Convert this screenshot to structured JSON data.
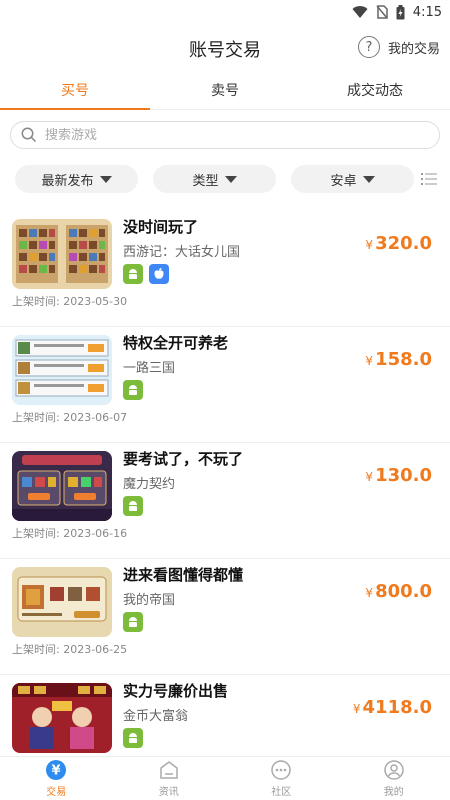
{
  "status": {
    "time": "4:15"
  },
  "header": {
    "title": "账号交易",
    "help_icon": "?",
    "my_trade": "我的交易"
  },
  "tabs": [
    {
      "label": "买号",
      "active": true
    },
    {
      "label": "卖号",
      "active": false
    },
    {
      "label": "成交动态",
      "active": false
    }
  ],
  "search": {
    "placeholder": "搜索游戏",
    "value": ""
  },
  "filters": [
    {
      "label": "最新发布"
    },
    {
      "label": "类型"
    },
    {
      "label": "安卓"
    }
  ],
  "listings": [
    {
      "name": "没时间玩了",
      "game": "西游记：大话女儿国",
      "platforms": [
        "android",
        "ios"
      ],
      "currency": "¥",
      "price": "320.0",
      "time": "上架时间: 2023-05-30"
    },
    {
      "name": "特权全开可养老",
      "game": "一路三国",
      "platforms": [
        "android"
      ],
      "currency": "¥",
      "price": "158.0",
      "time": "上架时间: 2023-06-07"
    },
    {
      "name": "要考试了，不玩了",
      "game": "魔力契约",
      "platforms": [
        "android"
      ],
      "currency": "¥",
      "price": "130.0",
      "time": "上架时间: 2023-06-16"
    },
    {
      "name": "进来看图懂得都懂",
      "game": "我的帝国",
      "platforms": [
        "android"
      ],
      "currency": "¥",
      "price": "800.0",
      "time": "上架时间: 2023-06-25"
    },
    {
      "name": "实力号廉价出售",
      "game": "金币大富翁",
      "platforms": [
        "android"
      ],
      "currency": "¥",
      "price": "4118.0",
      "time": ""
    }
  ],
  "bottom_nav": [
    {
      "label": "交易",
      "icon": "trade-icon",
      "active": true
    },
    {
      "label": "资讯",
      "icon": "news-icon",
      "active": false
    },
    {
      "label": "社区",
      "icon": "community-icon",
      "active": false
    },
    {
      "label": "我的",
      "icon": "profile-icon",
      "active": false
    }
  ],
  "colors": {
    "accent": "#f07a1e",
    "android": "#7dbb3a",
    "ios": "#3f86f6"
  }
}
